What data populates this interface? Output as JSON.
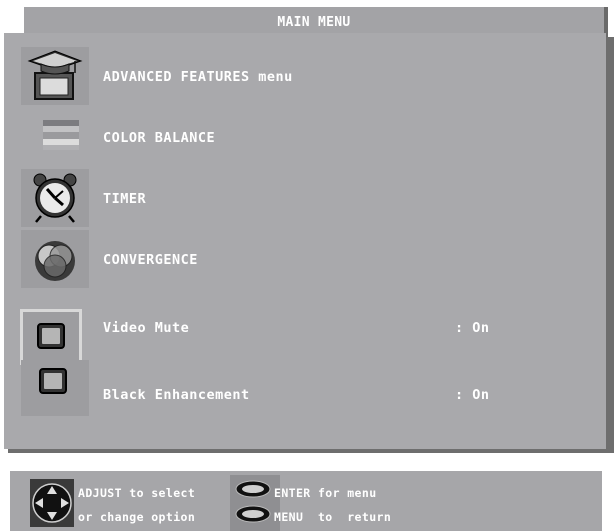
{
  "title": "MAIN MENU",
  "menu": {
    "items": [
      {
        "label": "ADVANCED FEATURES menu",
        "icon": "graduation-cap-icon"
      },
      {
        "label": "COLOR BALANCE",
        "icon": "color-bars-icon"
      },
      {
        "label": "TIMER",
        "icon": "alarm-clock-icon"
      },
      {
        "label": "CONVERGENCE",
        "icon": "convergence-circles-icon"
      },
      {
        "label": "Video Mute",
        "value": ": On",
        "icon": "monitor-icon"
      },
      {
        "label": "Black Enhancement",
        "value": ": On",
        "icon": "monitor-icon"
      }
    ]
  },
  "help": {
    "adjust_line1": "ADJUST to select",
    "adjust_line2": "or change option",
    "enter_text": "ENTER for menu",
    "menu_text": "MENU  to  return"
  },
  "colors": {
    "panel": "#a9a9ac",
    "panel_shadow": "#6e6e6e",
    "icon_box": "#9d9da0",
    "text": "#ffffff",
    "selected_border": "#d8d8d8"
  }
}
